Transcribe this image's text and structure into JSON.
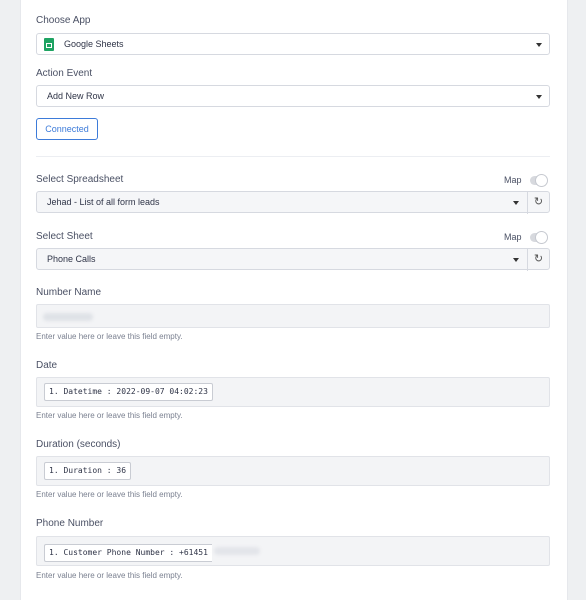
{
  "app": {
    "label": "Choose App",
    "value": "Google Sheets",
    "icon": "google-sheets-icon",
    "icon_color": "#1ea362"
  },
  "action": {
    "label": "Action Event",
    "value": "Add New Row"
  },
  "connected_label": "Connected",
  "spreadsheet": {
    "label": "Select Spreadsheet",
    "map_label": "Map",
    "value": "Jehad - List of all form leads"
  },
  "sheet": {
    "label": "Select Sheet",
    "map_label": "Map",
    "value": "Phone Calls"
  },
  "fields": {
    "number_name": {
      "label": "Number Name",
      "helper": "Enter value here or leave this field empty."
    },
    "date": {
      "label": "Date",
      "pill": "1. Datetime : 2022-09-07 04:02:23",
      "helper": "Enter value here or leave this field empty."
    },
    "duration": {
      "label": "Duration (seconds)",
      "pill": "1. Duration : 36",
      "helper": "Enter value here or leave this field empty."
    },
    "phone": {
      "label": "Phone Number",
      "pill": "1. Customer Phone Number : +61451",
      "helper": "Enter value here or leave this field empty."
    }
  },
  "colors": {
    "accent": "#3d7bd9",
    "background": "#eef0f2"
  }
}
